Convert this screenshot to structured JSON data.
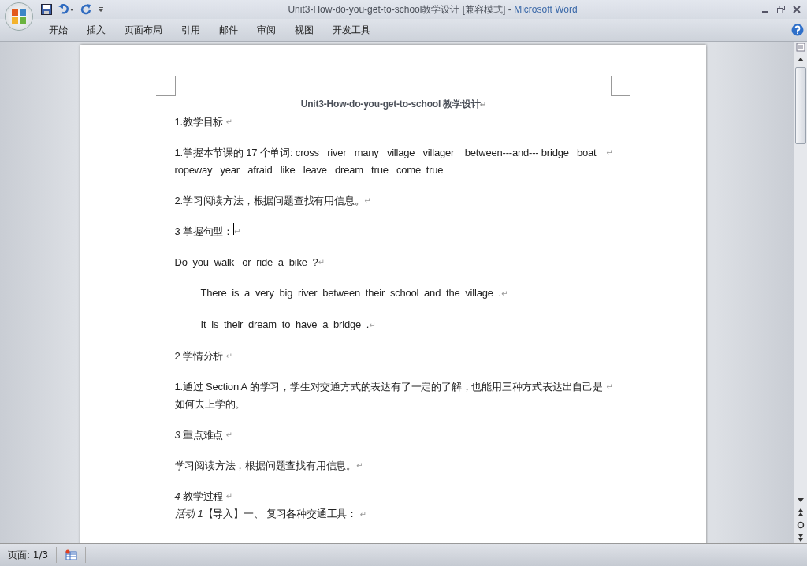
{
  "window": {
    "title": "Unit3-How-do-you-get-to-school教学设计 [兼容模式]",
    "separator": "-",
    "app_name": "Microsoft Word"
  },
  "ribbon_tabs": [
    {
      "label": "开始",
      "selected": false
    },
    {
      "label": "插入",
      "selected": false
    },
    {
      "label": "页面布局",
      "selected": false
    },
    {
      "label": "引用",
      "selected": false
    },
    {
      "label": "邮件",
      "selected": false
    },
    {
      "label": "审阅",
      "selected": false
    },
    {
      "label": "视图",
      "selected": false
    },
    {
      "label": "开发工具",
      "selected": false
    }
  ],
  "document": {
    "paragraphs": [
      {
        "kind": "title",
        "text": "Unit3-How-do-you-get-to-school 教学设计",
        "mark": "↵"
      },
      {
        "kind": "body",
        "text": "1.教学目标 ",
        "mark": "↵"
      },
      {
        "kind": "body",
        "text": "1.掌握本节课的 17 个单词: cross   river   many   village   villager    between---and--- bridge   boat   ropeway   year   afraid   like   leave   dream   true   come  true",
        "mark": "↵"
      },
      {
        "kind": "body",
        "text": "2.学习阅读方法，根据问题查找有用信息。",
        "mark": "↵"
      },
      {
        "kind": "body",
        "text": "3 掌握句型：",
        "mark": "↵",
        "cursor": true
      },
      {
        "kind": "body",
        "text": "Do  you  walk   or  ride  a  bike  ?",
        "mark": "↵"
      },
      {
        "kind": "indent",
        "text": "There  is  a  very  big  river  between  their  school  and  the  village  .",
        "mark": "↵"
      },
      {
        "kind": "indent",
        "text": "It  is  their  dream  to  have  a  bridge  .",
        "mark": "↵"
      },
      {
        "kind": "body",
        "text": "2 学情分析 ",
        "mark": "↵"
      },
      {
        "kind": "body",
        "text": "1.通过 Section A 的学习，学生对交通方式的表达有了一定的了解，也能用三种方式表达出自己是如何去上学的。",
        "mark": "↵"
      },
      {
        "kind": "body",
        "text": "*3* 重点难点 ",
        "mark": "↵"
      },
      {
        "kind": "body",
        "text": "学习阅读方法，根据问题查找有用信息。",
        "mark": "↵"
      },
      {
        "kind": "body",
        "text": "*4* 教学过程 ",
        "mark": "↵"
      },
      {
        "kind": "continuation",
        "text": "*活动 1*【导入】一、 复习各种交通工具： ",
        "mark": "↵"
      }
    ]
  },
  "status_bar": {
    "page": "页面: 1/3"
  }
}
